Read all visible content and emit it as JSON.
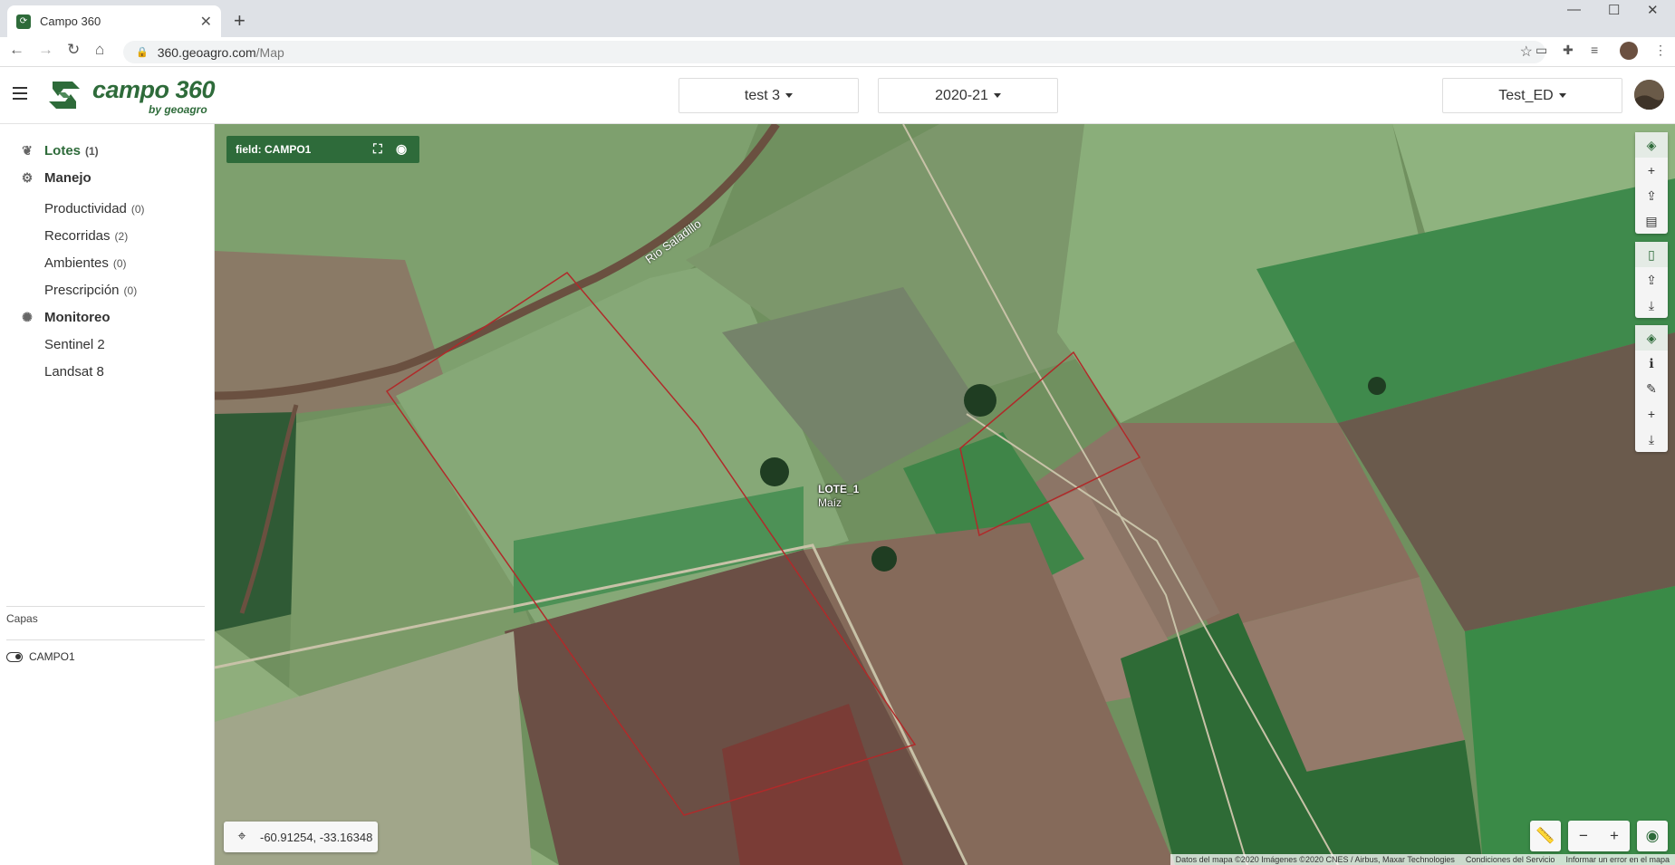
{
  "browser": {
    "tab_title": "Campo 360",
    "tab_close": "✕",
    "new_tab": "+",
    "url_host": "360.geoagro.com",
    "url_path": "/Map",
    "window_controls": [
      "—",
      "☐",
      "✕"
    ]
  },
  "header": {
    "logo_text": "campo 360",
    "logo_sub": "by geoagro",
    "selectors": [
      {
        "label": "test 3"
      },
      {
        "label": "2020-21"
      },
      {
        "label": "Test_ED"
      }
    ]
  },
  "sidebar": {
    "sections": [
      {
        "label": "Lotes",
        "count": "(1)",
        "icon": "seedling-icon"
      },
      {
        "label": "Manejo",
        "icon": "tractor-icon"
      },
      {
        "label": "Monitoreo",
        "icon": "satellite-icon"
      }
    ],
    "manejo_items": [
      {
        "label": "Productividad",
        "count": "(0)"
      },
      {
        "label": "Recorridas",
        "count": "(2)"
      },
      {
        "label": "Ambientes",
        "count": "(0)"
      },
      {
        "label": "Prescripción",
        "count": "(0)"
      }
    ],
    "monitoreo_items": [
      {
        "label": "Sentinel 2"
      },
      {
        "label": "Landsat 8"
      }
    ],
    "capas_label": "Capas",
    "layers": [
      {
        "label": "CAMPO1"
      }
    ]
  },
  "map": {
    "field_chip": "field: CAMPO1",
    "river_label": "Rio Saladillo",
    "lote_name": "LOTE_1",
    "lote_crop": "Maíz",
    "coords": "-60.91254, -33.16348",
    "attribution": [
      "Datos del mapa ©2020 Imágenes ©2020 CNES / Airbus, Maxar Technologies",
      "Condiciones del Servicio",
      "Informar un error en el mapa"
    ],
    "colors": {
      "accent": "#2e6b3a",
      "field_border": "#b02a2a"
    }
  }
}
